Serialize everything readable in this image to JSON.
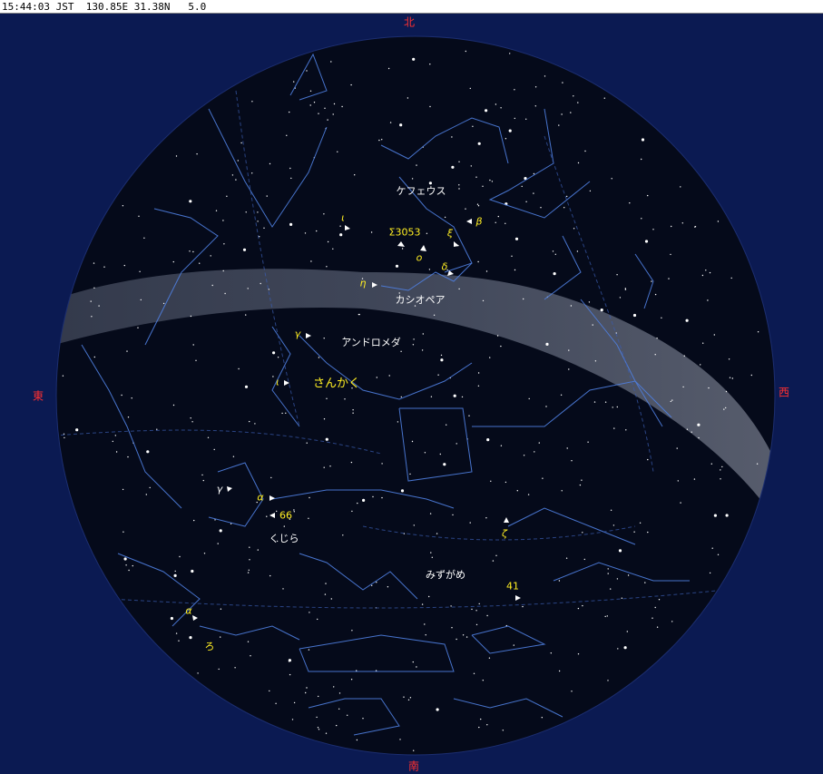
{
  "status": {
    "time": "15:44:03 JST",
    "longitude": "130.85E",
    "latitude": "31.38N",
    "magnitude_limit": "5.0"
  },
  "directions": {
    "north": "北",
    "south": "南",
    "east": "東",
    "west": "西"
  },
  "constellations": {
    "cepheus": "ケフェウス",
    "cassiopeia": "カシオペア",
    "andromeda": "アンドロメダ",
    "triangulum": "さんかく",
    "cetus": "くじら",
    "aquarius": "みずがめ"
  },
  "star_labels": {
    "iota_cep": "ι",
    "beta_cep": "β",
    "sigma3053": "Σ3053",
    "xi_cep": "ξ",
    "omicron_cas": "o",
    "delta_cas": "δ",
    "eta_cas": "η",
    "gamma_and": "γ",
    "iota_tri": "ι",
    "gamma_cet": "γ",
    "alpha_cet": "α",
    "star_66": "66",
    "zeta_aqr": "ζ",
    "star_41": "41",
    "alpha_scl": "α",
    "ro_scl": "ろ"
  },
  "colors": {
    "sky_background": "#0b1a52",
    "horizon_disc": "#050a1a",
    "constellation_line": "#4f7fe0",
    "direction_label": "#ff3030",
    "star_label": "#ffee22",
    "constellation_name": "#ffffff"
  }
}
